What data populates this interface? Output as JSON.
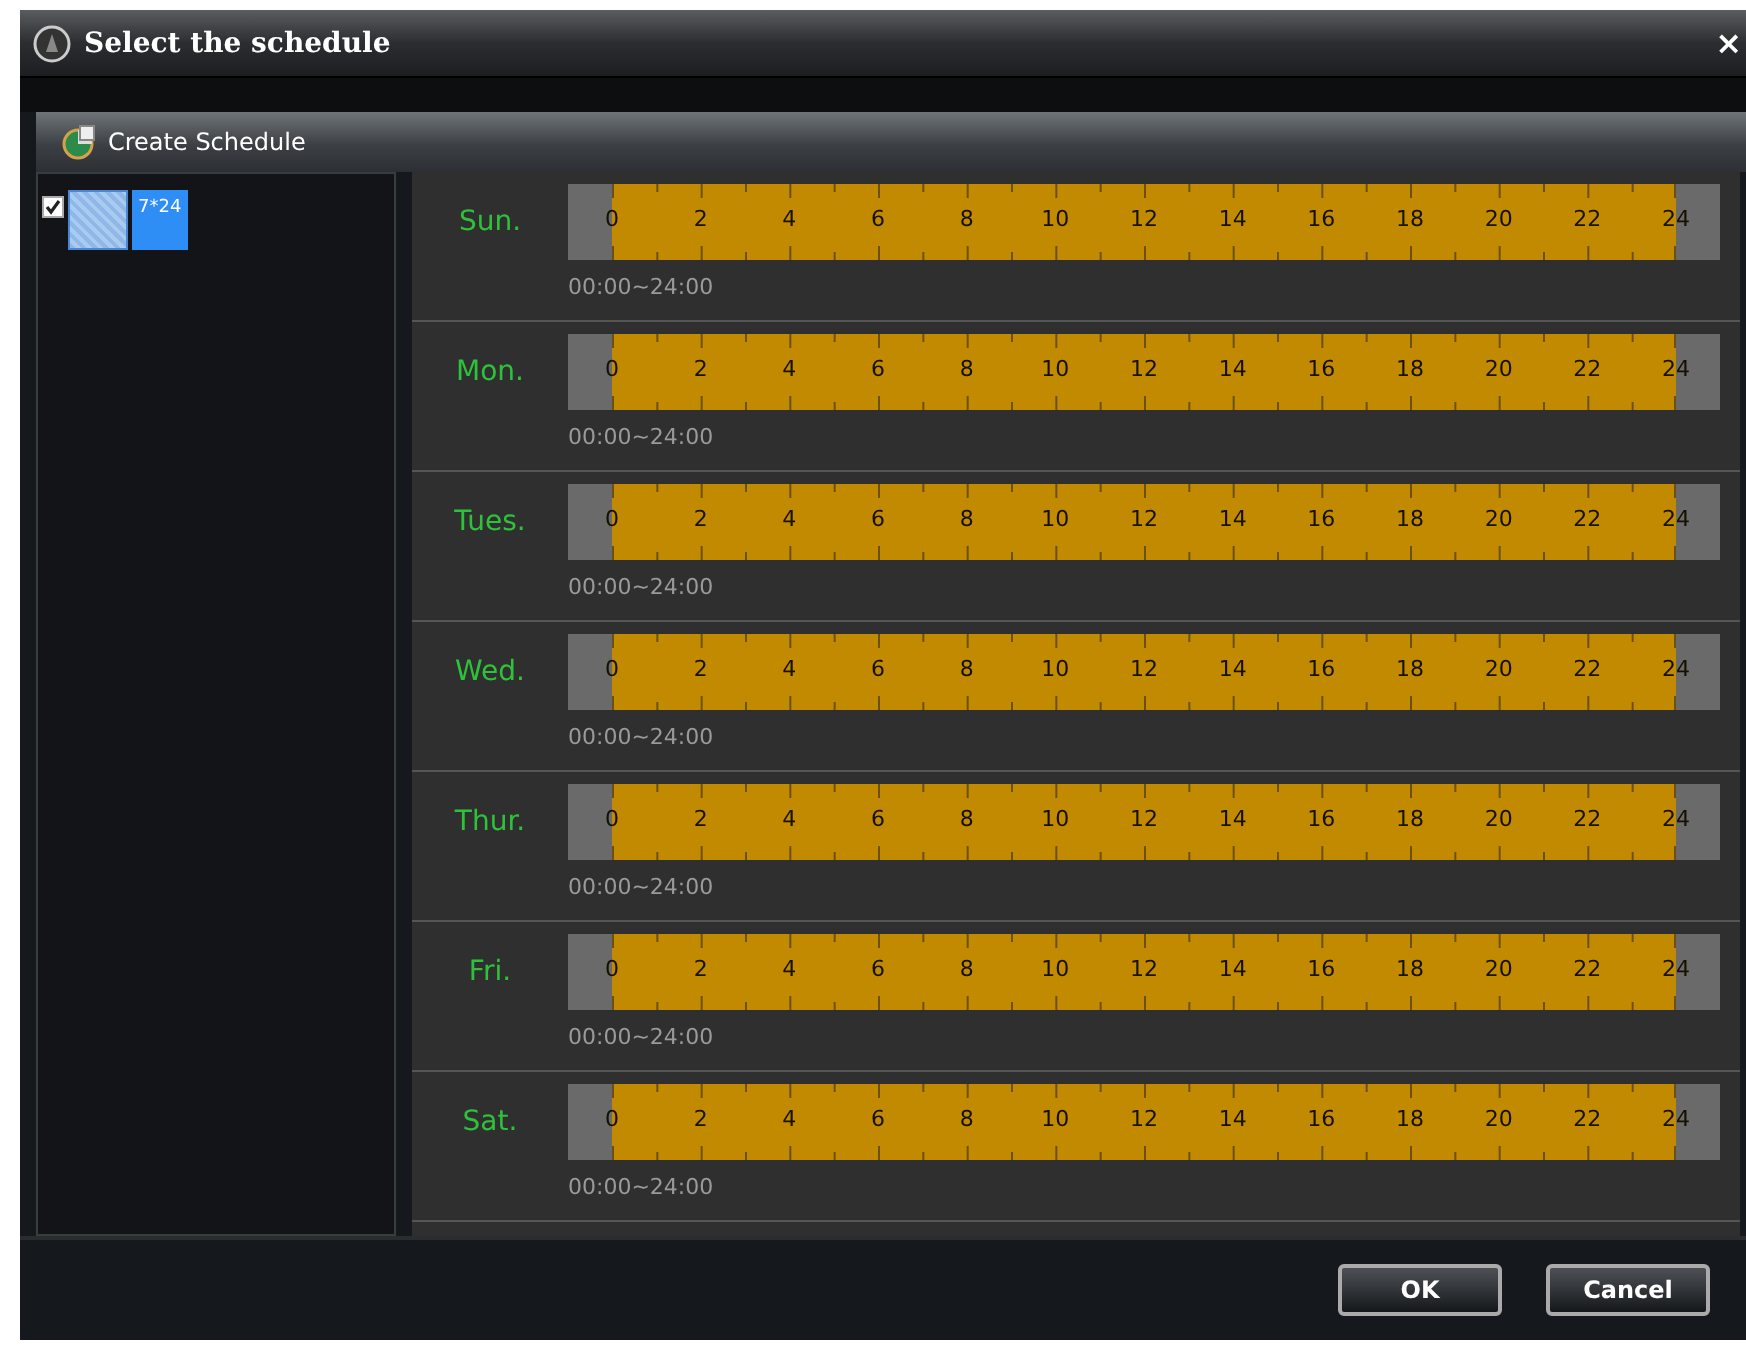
{
  "window": {
    "title": "Select the schedule",
    "close": "×"
  },
  "toolbar": {
    "label": "Create Schedule"
  },
  "tree": {
    "items": [
      {
        "label": "7*24",
        "checked": true,
        "selected": true
      }
    ]
  },
  "days": [
    {
      "name": "Sun.",
      "range": "00:00~24:00",
      "hours": [
        "0",
        "2",
        "4",
        "6",
        "8",
        "10",
        "12",
        "14",
        "16",
        "18",
        "20",
        "22",
        "24"
      ]
    },
    {
      "name": "Mon.",
      "range": "00:00~24:00",
      "hours": [
        "0",
        "2",
        "4",
        "6",
        "8",
        "10",
        "12",
        "14",
        "16",
        "18",
        "20",
        "22",
        "24"
      ]
    },
    {
      "name": "Tues.",
      "range": "00:00~24:00",
      "hours": [
        "0",
        "2",
        "4",
        "6",
        "8",
        "10",
        "12",
        "14",
        "16",
        "18",
        "20",
        "22",
        "24"
      ]
    },
    {
      "name": "Wed.",
      "range": "00:00~24:00",
      "hours": [
        "0",
        "2",
        "4",
        "6",
        "8",
        "10",
        "12",
        "14",
        "16",
        "18",
        "20",
        "22",
        "24"
      ]
    },
    {
      "name": "Thur.",
      "range": "00:00~24:00",
      "hours": [
        "0",
        "2",
        "4",
        "6",
        "8",
        "10",
        "12",
        "14",
        "16",
        "18",
        "20",
        "22",
        "24"
      ]
    },
    {
      "name": "Fri.",
      "range": "00:00~24:00",
      "hours": [
        "0",
        "2",
        "4",
        "6",
        "8",
        "10",
        "12",
        "14",
        "16",
        "18",
        "20",
        "22",
        "24"
      ]
    },
    {
      "name": "Sat.",
      "range": "00:00~24:00",
      "hours": [
        "0",
        "2",
        "4",
        "6",
        "8",
        "10",
        "12",
        "14",
        "16",
        "18",
        "20",
        "22",
        "24"
      ]
    }
  ],
  "buttons": [
    "OK",
    "Cancel"
  ]
}
